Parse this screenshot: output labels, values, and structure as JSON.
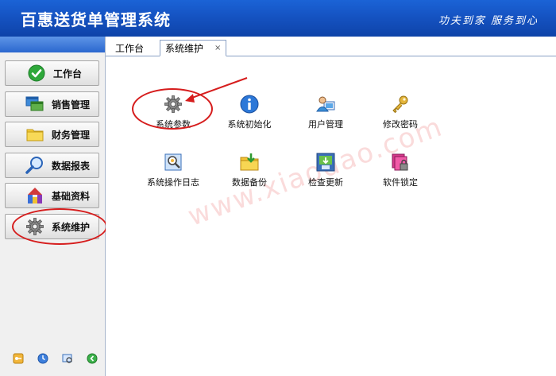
{
  "app": {
    "title": "百惠送货单管理系统",
    "slogan": "功夫到家 服务到心"
  },
  "sidebar": {
    "items": [
      {
        "label": "工作台",
        "icon": "check-icon"
      },
      {
        "label": "销售管理",
        "icon": "windows-icon"
      },
      {
        "label": "财务管理",
        "icon": "folder-icon"
      },
      {
        "label": "数据报表",
        "icon": "magnifier-icon"
      },
      {
        "label": "基础资料",
        "icon": "blocks-icon"
      },
      {
        "label": "系统维护",
        "icon": "gear-icon"
      }
    ],
    "bottom_icons": [
      "key-icon",
      "clock-icon",
      "search-icon",
      "refresh-icon"
    ]
  },
  "tabs": [
    {
      "label": "工作台"
    },
    {
      "label": "系统维护",
      "close": "×"
    }
  ],
  "main": {
    "functions": [
      {
        "label": "系统参数",
        "icon": "gear-icon"
      },
      {
        "label": "系统初始化",
        "icon": "info-icon"
      },
      {
        "label": "用户管理",
        "icon": "user-icon"
      },
      {
        "label": "修改密码",
        "icon": "key-icon"
      },
      {
        "label": "系统操作日志",
        "icon": "log-icon"
      },
      {
        "label": "数据备份",
        "icon": "backup-icon"
      },
      {
        "label": "检查更新",
        "icon": "update-icon"
      },
      {
        "label": "软件锁定",
        "icon": "lock-icon"
      }
    ],
    "watermark": "www.xiaodao.com"
  },
  "colors": {
    "titlebar": "#1553c2",
    "annotation": "#d61d1d"
  }
}
